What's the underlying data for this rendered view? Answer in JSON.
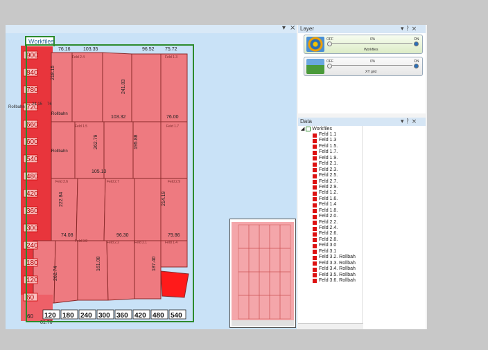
{
  "map": {
    "workspace_tab": "Workfiles",
    "ctrl_pin": "▾",
    "ctrl_close": "×",
    "y_labels": [
      "900",
      "840",
      "780",
      "720",
      "660",
      "600",
      "540",
      "480",
      "420",
      "360",
      "300",
      "240",
      "180",
      "120",
      "60"
    ],
    "x_labels": [
      "120",
      "180",
      "240",
      "300",
      "360",
      "420",
      "480",
      "540"
    ],
    "x_zero": "60",
    "field_numbers": [
      "76.16",
      "103.35",
      "96.52",
      "75.72",
      "218.15",
      "241.83",
      "103.32",
      "76.00",
      "262.79",
      "105.10",
      "195.88",
      "222.84",
      "214.19",
      "74.08",
      "96.30",
      "79.86",
      "262.74",
      "161.08",
      "187.40",
      "81.76"
    ],
    "field_numbers_small": [
      "Feld 2.4",
      "Feld 1.3",
      "Feld 1.5",
      "Feld 1.7",
      "Feld 2.6",
      "Feld 2.7",
      "Feld 2.9",
      "Feld 3.8",
      "Feld 2.2",
      "Feld 2.1",
      "Feld 1.4"
    ],
    "rollbahn": [
      "Rollbahn",
      "Rollbahn"
    ],
    "side_labels": [
      "Rollbahn",
      "24.15",
      "76"
    ]
  },
  "layer_panel": {
    "title": "Layer",
    "ctrl": "▾ ᚹ ×",
    "layers": [
      {
        "name": "Workfiles",
        "off": "OFF",
        "on": "ON",
        "pct": "0%",
        "color": "#8fc85a"
      },
      {
        "name": "XY grid",
        "off": "OFF",
        "on": "ON",
        "pct": "0%",
        "color": "#cccccc"
      }
    ]
  },
  "data_panel": {
    "title": "Data",
    "ctrl": "▾ ᚹ ×",
    "root": "Workfiles",
    "items": [
      "Feld 1.1",
      "Feld 1.3",
      "Feld 1.5.",
      "Feld 1.7.",
      "Feld 1.9.",
      "Feld 2.1.",
      "Feld 2.3.",
      "Feld 2.5.",
      "Feld 2.7.",
      "Feld 2.9.",
      "Feld 1.2.",
      "Feld 1.6.",
      "Feld 1.4",
      "Feld 1.8.",
      "Feld 2.0.",
      "Feld 2.2.",
      "Feld 2.4.",
      "Feld 2.6.",
      "Feld 2.8.",
      "Feld 3.0",
      "Feld 3.1",
      "Feld 3.2. Rollbah",
      "Feld 3.3. Rollbah",
      "Feld 3.4. Rollbah",
      "Feld 3.5. Rollbah",
      "Feld 3.6. Rollbah"
    ],
    "swatch_color": "#dd1111"
  }
}
